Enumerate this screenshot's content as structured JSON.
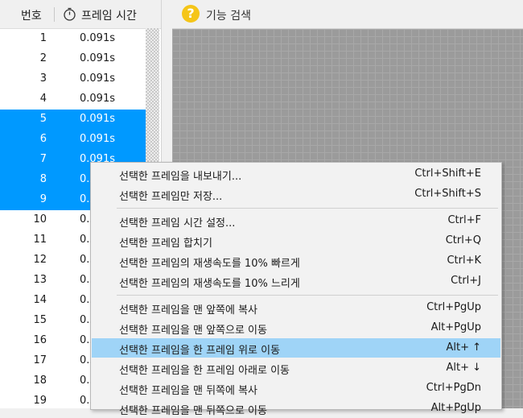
{
  "list_header": {
    "number_col": "번호",
    "time_col": "프레임 시간"
  },
  "frames": [
    {
      "num": "1",
      "time": "0.091s",
      "selected": false
    },
    {
      "num": "2",
      "time": "0.091s",
      "selected": false
    },
    {
      "num": "3",
      "time": "0.091s",
      "selected": false
    },
    {
      "num": "4",
      "time": "0.091s",
      "selected": false
    },
    {
      "num": "5",
      "time": "0.091s",
      "selected": true
    },
    {
      "num": "6",
      "time": "0.091s",
      "selected": true
    },
    {
      "num": "7",
      "time": "0.091s",
      "selected": true
    },
    {
      "num": "8",
      "time": "0.",
      "selected": true
    },
    {
      "num": "9",
      "time": "0.",
      "selected": true
    },
    {
      "num": "10",
      "time": "0.",
      "selected": false
    },
    {
      "num": "11",
      "time": "0.",
      "selected": false
    },
    {
      "num": "12",
      "time": "0.",
      "selected": false
    },
    {
      "num": "13",
      "time": "0.",
      "selected": false
    },
    {
      "num": "14",
      "time": "0.",
      "selected": false
    },
    {
      "num": "15",
      "time": "0.",
      "selected": false
    },
    {
      "num": "16",
      "time": "0.",
      "selected": false
    },
    {
      "num": "17",
      "time": "0.",
      "selected": false
    },
    {
      "num": "18",
      "time": "0.",
      "selected": false
    },
    {
      "num": "19",
      "time": "0.",
      "selected": false
    }
  ],
  "toolbar": {
    "search_label": "기능 검색",
    "search_icon": "?"
  },
  "context_menu": {
    "groups": [
      [
        {
          "label": "선택한 프레임을 내보내기...",
          "shortcut": "Ctrl+Shift+E"
        },
        {
          "label": "선택한 프레임만 저장...",
          "shortcut": "Ctrl+Shift+S"
        }
      ],
      [
        {
          "label": "선택한 프레임 시간 설정...",
          "shortcut": "Ctrl+F"
        },
        {
          "label": "선택한 프레임 합치기",
          "shortcut": "Ctrl+Q"
        },
        {
          "label": "선택한 프레임의 재생속도를 10% 빠르게",
          "shortcut": "Ctrl+K"
        },
        {
          "label": "선택한 프레임의 재생속도를 10% 느리게",
          "shortcut": "Ctrl+J"
        }
      ],
      [
        {
          "label": "선택한 프레임을 맨 앞쪽에 복사",
          "shortcut": "Ctrl+PgUp"
        },
        {
          "label": "선택한 프레임을 맨 앞쪽으로 이동",
          "shortcut": "Alt+PgUp"
        },
        {
          "label": "선택한 프레임을 한 프레임 위로 이동",
          "shortcut": "Alt+ ↑",
          "highlighted": true
        },
        {
          "label": "선택한 프레임을 한 프레임 아래로 이동",
          "shortcut": "Alt+ ↓"
        },
        {
          "label": "선택한 프레임을 맨 뒤쪽에 복사",
          "shortcut": "Ctrl+PgDn"
        },
        {
          "label": "선택한 프레임을 맨 뒤쪽으로 이동",
          "shortcut": "Alt+PgUp"
        }
      ]
    ]
  },
  "colors": {
    "selection": "#0099ff",
    "menu_highlight": "#9fd4f7",
    "search_icon": "#f5c518"
  }
}
